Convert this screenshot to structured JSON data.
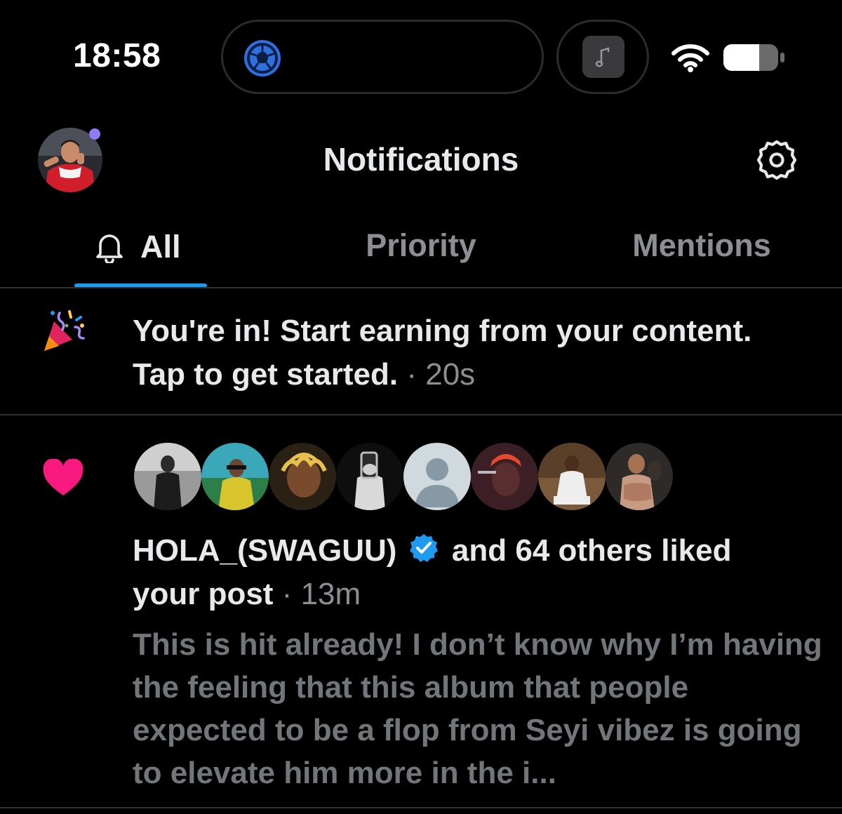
{
  "status_bar": {
    "time": "18:58"
  },
  "header": {
    "title": "Notifications",
    "avatar_icon": "profile-avatar",
    "settings_icon": "gear-icon"
  },
  "tabs": [
    {
      "label": "All",
      "icon": "bell-icon",
      "active": true
    },
    {
      "label": "Priority",
      "active": false
    },
    {
      "label": "Mentions",
      "active": false
    }
  ],
  "notifications": [
    {
      "icon": "party-popper-icon",
      "line1": "You're in! Start earning from your content.",
      "line2": "Tap to get started.",
      "separator": " · ",
      "time": "20s"
    },
    {
      "icon": "heart-icon",
      "user": "HOLA_(SWAGUU)",
      "verified": true,
      "action_line1": "and 64 others liked",
      "action_line2": "your post",
      "separator": " · ",
      "time": "13m",
      "post_preview": "This is hit already! I don’t know why I’m having the feeling that this album that people expected to be a flop from Seyi vibez is going to elevate him more in the i..."
    }
  ],
  "colors": {
    "background": "#000000",
    "accent": "#1d9bf0",
    "heart": "#f91880",
    "muted_text": "#71767b",
    "tab_inactive": "#8b8f94",
    "divider": "#2f3336"
  }
}
